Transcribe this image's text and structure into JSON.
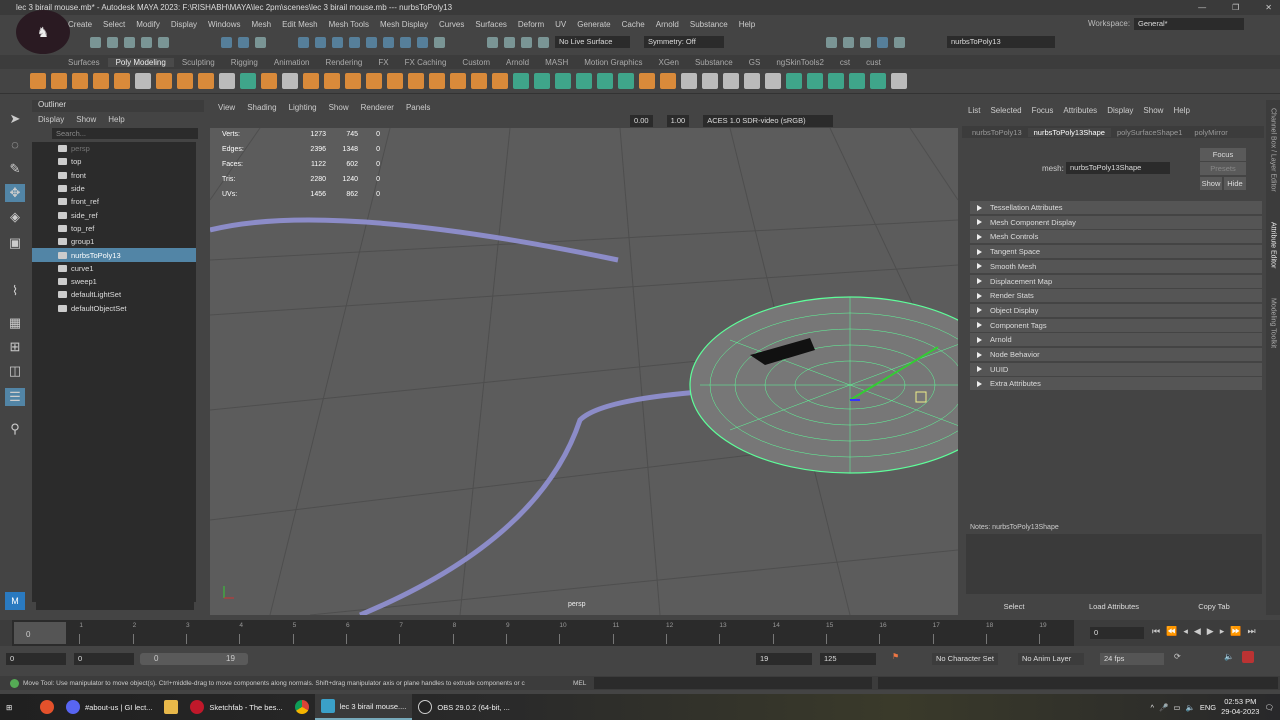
{
  "title": "lec 3 birail mouse.mb* - Autodesk MAYA 2023: F:\\RISHABH\\MAYA\\lec 2pm\\scenes\\lec 3 birail mouse.mb  ---  nurbsToPoly13",
  "menu": [
    "Create",
    "Select",
    "Modify",
    "Display",
    "Windows",
    "Mesh",
    "Edit Mesh",
    "Mesh Tools",
    "Mesh Display",
    "Curves",
    "Surfaces",
    "Deform",
    "UV",
    "Generate",
    "Cache",
    "Arnold",
    "Substance",
    "Help"
  ],
  "workspace": {
    "label": "Workspace:",
    "value": "General*"
  },
  "status": {
    "live_surface": "No Live Surface",
    "symmetry": "Symmetry: Off",
    "object_field": "nurbsToPoly13"
  },
  "shelf_tabs": [
    "Surfaces",
    "Poly Modeling",
    "Sculpting",
    "Rigging",
    "Animation",
    "Rendering",
    "FX",
    "FX Caching",
    "Custom",
    "Arnold",
    "MASH",
    "Motion Graphics",
    "XGen",
    "Substance",
    "GS",
    "ngSkinTools2",
    "cst",
    "cust"
  ],
  "shelf_active": "Poly Modeling",
  "outliner": {
    "title": "Outliner",
    "menu": [
      "Display",
      "Show",
      "Help"
    ],
    "search_placeholder": "Search...",
    "items": [
      "persp",
      "top",
      "front",
      "side",
      "front_ref",
      "side_ref",
      "top_ref",
      "group1",
      "nurbsToPoly13",
      "curve1",
      "sweep1",
      "defaultLightSet",
      "defaultObjectSet"
    ],
    "selected": "nurbsToPoly13"
  },
  "viewport": {
    "menu": [
      "View",
      "Shading",
      "Lighting",
      "Show",
      "Renderer",
      "Panels"
    ],
    "exposure": "0.00",
    "gamma": "1.00",
    "color_space": "ACES 1.0 SDR-video (sRGB)",
    "camera": "persp",
    "hud": [
      [
        "Verts:",
        "1273",
        "745",
        "0"
      ],
      [
        "Edges:",
        "2396",
        "1348",
        "0"
      ],
      [
        "Faces:",
        "1122",
        "602",
        "0"
      ],
      [
        "Tris:",
        "2280",
        "1240",
        "0"
      ],
      [
        "UVs:",
        "1456",
        "862",
        "0"
      ]
    ]
  },
  "attr": {
    "menu": [
      "List",
      "Selected",
      "Focus",
      "Attributes",
      "Display",
      "Show",
      "Help"
    ],
    "tabs": [
      "nurbsToPoly13",
      "nurbsToPoly13Shape",
      "polySurfaceShape1",
      "polyMirror"
    ],
    "active_tab": "nurbsToPoly13Shape",
    "mesh_label": "mesh:",
    "mesh_value": "nurbsToPoly13Shape",
    "focus": "Focus",
    "presets": "Presets",
    "show": "Show",
    "hide": "Hide",
    "sections": [
      "Tessellation Attributes",
      "Mesh Component Display",
      "Mesh Controls",
      "Tangent Space",
      "Smooth Mesh",
      "Displacement Map",
      "Render Stats",
      "Object Display",
      "Component Tags",
      "Arnold",
      "Node Behavior",
      "UUID",
      "Extra Attributes"
    ],
    "notes": "Notes:  nurbsToPoly13Shape",
    "select": "Select",
    "load": "Load Attributes",
    "copy": "Copy Tab"
  },
  "side_tabs": [
    "Channel Box / Layer Editor",
    "Attribute Editor",
    "Modeling Toolkit"
  ],
  "timeline": {
    "ticks": [
      "0",
      "1",
      "2",
      "3",
      "4",
      "5",
      "6",
      "7",
      "8",
      "9",
      "10",
      "11",
      "12",
      "13",
      "14",
      "15",
      "16",
      "17",
      "18",
      "19"
    ],
    "current": "0",
    "current_field": "0"
  },
  "range": {
    "start": "0",
    "anim_start": "0",
    "slider_start": "0",
    "slider_end": "19",
    "end": "19",
    "anim_end": "125",
    "character_set": "No Character Set",
    "anim_layer": "No Anim Layer",
    "fps": "24 fps"
  },
  "helpline": {
    "text": "Move Tool: Use manipulator to move object(s). Ctrl+middle-drag to move components along normals. Shift+drag manipulator axis or plane handles to extrude components or c",
    "mel": "MEL"
  },
  "taskbar": {
    "items": [
      "#about-us | GI lect...",
      "Sketchfab - The bes...",
      "lec 3 birail mouse....",
      "OBS 29.0.2 (64-bit, ..."
    ],
    "lang": "ENG",
    "time": "02:53 PM",
    "date": "29-04-2023"
  }
}
